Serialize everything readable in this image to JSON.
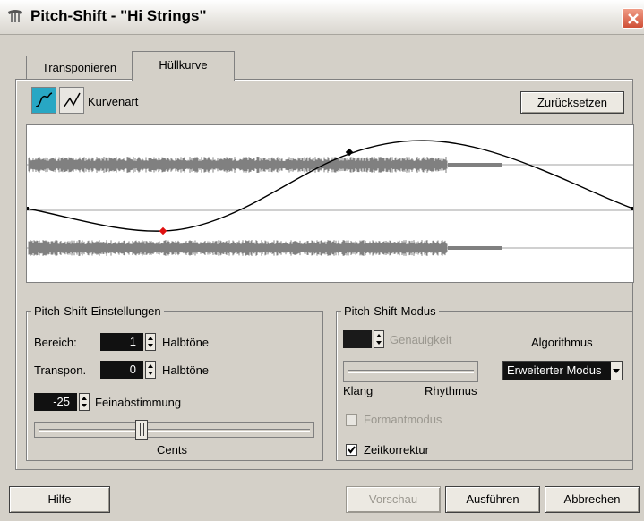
{
  "window": {
    "title": "Pitch-Shift - \"Hi Strings\""
  },
  "tabs": [
    {
      "label": "Transponieren"
    },
    {
      "label": "Hüllkurve"
    }
  ],
  "envelope": {
    "curve_type_label": "Kurvenart",
    "reset_label": "Zurücksetzen"
  },
  "settings": {
    "group_title": "Pitch-Shift-Einstellungen",
    "range_label": "Bereich:",
    "range_value": "1",
    "range_unit": "Halbtöne",
    "transpose_label": "Transpon.",
    "transpose_value": "0",
    "transpose_unit": "Halbtöne",
    "fine_value": "-25",
    "fine_label": "Feinabstimmung",
    "cents_label": "Cents"
  },
  "mode": {
    "group_title": "Pitch-Shift-Modus",
    "accuracy_label": "Genauigkeit",
    "algorithm_label": "Algorithmus",
    "algorithm_value": "Erweiterter Modus",
    "klang_label": "Klang",
    "rhythmus_label": "Rhythmus",
    "formant_label": "Formantmodus",
    "time_correction_label": "Zeitkorrektur"
  },
  "buttons": {
    "help": "Hilfe",
    "preview": "Vorschau",
    "execute": "Ausführen",
    "cancel": "Abbrechen"
  },
  "colors": {
    "waveform": "#808080",
    "curve": "#000000",
    "selected_point": "#e01010",
    "active_curve_button": "#28a7c4"
  }
}
